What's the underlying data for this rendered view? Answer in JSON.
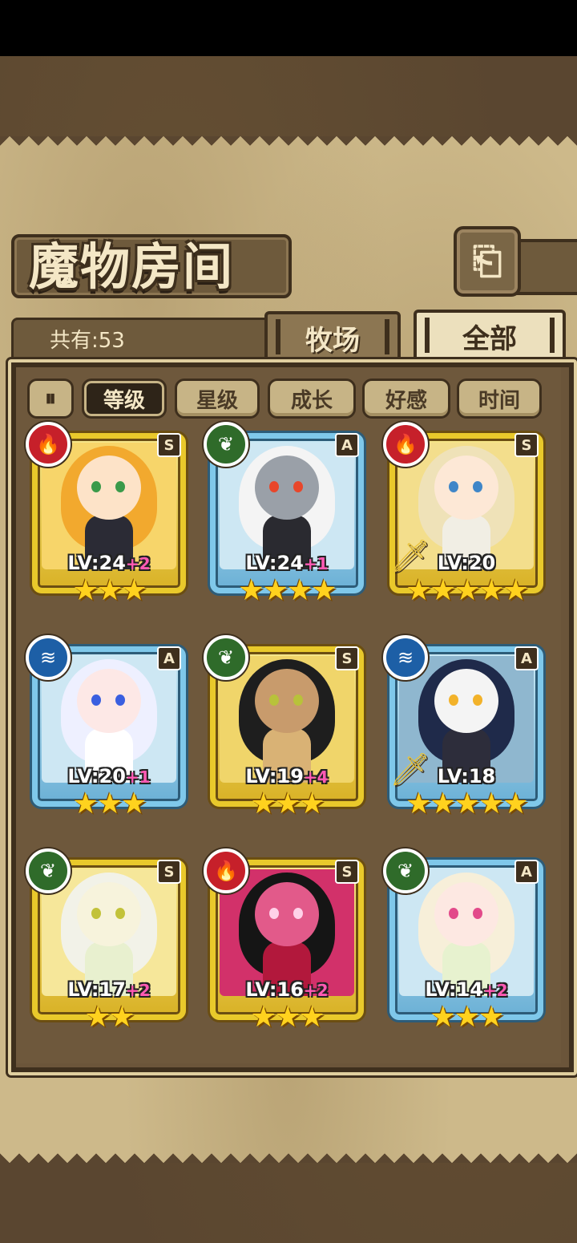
{
  "screen": {
    "title": "魔物房间",
    "back_icon": "⎗",
    "count_label": "共有:53",
    "tabs": [
      {
        "label": "牧场",
        "active": false
      },
      {
        "label": "全部",
        "active": true
      }
    ],
    "sort_toggle": "⏸",
    "sort_buttons": [
      {
        "label": "等级",
        "active": true
      },
      {
        "label": "星级",
        "active": false
      },
      {
        "label": "成长",
        "active": false
      },
      {
        "label": "好感",
        "active": false
      },
      {
        "label": "时间",
        "active": false
      }
    ]
  },
  "colors": {
    "fire": "#c6202a",
    "grass": "#2f6b2a",
    "water": "#1d5fa6",
    "gold_frame": "#e9c92b",
    "blue_frame": "#7fc8ea"
  },
  "monsters": [
    {
      "element": "fire",
      "element_icon": "flame-icon",
      "rank": "S",
      "frame": "gold",
      "lv": "LV:24",
      "plus": "+2",
      "stars": "★★★",
      "weapon": false
    },
    {
      "element": "grass",
      "element_icon": "leaf-icon",
      "rank": "A",
      "frame": "blue",
      "lv": "LV:24",
      "plus": "+1",
      "stars": "★★★★",
      "weapon": false
    },
    {
      "element": "fire",
      "element_icon": "flame-icon",
      "rank": "S",
      "frame": "gold",
      "lv": "LV:20",
      "plus": "",
      "stars": "★★★★★",
      "weapon": true
    },
    {
      "element": "water",
      "element_icon": "water-icon",
      "rank": "A",
      "frame": "blue",
      "lv": "LV:20",
      "plus": "+1",
      "stars": "★★★",
      "weapon": false
    },
    {
      "element": "grass",
      "element_icon": "leaf-icon",
      "rank": "S",
      "frame": "gold",
      "lv": "LV:19",
      "plus": "+4",
      "stars": "★★★",
      "weapon": false
    },
    {
      "element": "water",
      "element_icon": "water-icon",
      "rank": "A",
      "frame": "blue",
      "lv": "LV:18",
      "plus": "",
      "stars": "★★★★★",
      "weapon": true
    },
    {
      "element": "grass",
      "element_icon": "leaf-icon",
      "rank": "S",
      "frame": "gold",
      "lv": "LV:17",
      "plus": "+2",
      "stars": "★★",
      "weapon": false
    },
    {
      "element": "fire",
      "element_icon": "flame-icon",
      "rank": "S",
      "frame": "gold",
      "lv": "LV:16",
      "plus": "+2",
      "stars": "★★★",
      "weapon": false
    },
    {
      "element": "grass",
      "element_icon": "leaf-icon",
      "rank": "A",
      "frame": "blue",
      "lv": "LV:14",
      "plus": "+2",
      "stars": "★★★",
      "weapon": false
    }
  ]
}
